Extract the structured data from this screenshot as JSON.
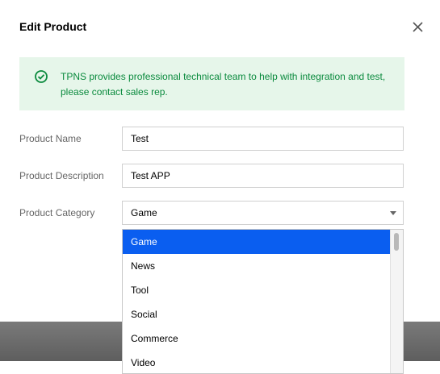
{
  "dialog": {
    "title": "Edit Product",
    "close_icon": "close-icon"
  },
  "notice": {
    "icon": "check-circle-icon",
    "text": "TPNS provides professional technical team to help with integration and test, please contact sales rep.",
    "color": "#0a8a3d",
    "background": "#e6f6ea"
  },
  "form": {
    "product_name": {
      "label": "Product Name",
      "value": "Test"
    },
    "product_description": {
      "label": "Product Description",
      "value": "Test APP"
    },
    "product_category": {
      "label": "Product Category",
      "value": "Game"
    }
  },
  "dropdown": {
    "options": [
      "Game",
      "News",
      "Tool",
      "Social",
      "Commerce",
      "Video"
    ],
    "selected": "Game",
    "highlight_color": "#0a5ef0"
  }
}
